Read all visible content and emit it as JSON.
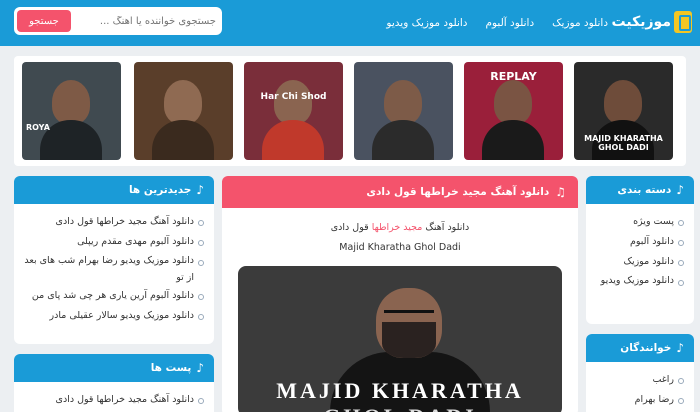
{
  "header": {
    "logo_text": "موزیکیت",
    "nav": [
      "دانلود موزیک",
      "دانلود آلبوم",
      "دانلود موزیک ویدیو"
    ],
    "search_placeholder": "جستجوی خواننده یا آهنگ ...",
    "search_button": "جستجو"
  },
  "carousel": {
    "cards": [
      {
        "label": "MAJID KHARATHA GHOL DADI",
        "bg": "#2a2a2a"
      },
      {
        "label": "REPLAY",
        "bg": "#9a1f3a"
      },
      {
        "label": "",
        "bg": "#4a5260"
      },
      {
        "label": "Har Chi Shod",
        "bg": "#7a2e3a"
      },
      {
        "label": "",
        "bg": "#5a3e2a"
      },
      {
        "label": "ROYA",
        "bg": "#404a50"
      }
    ]
  },
  "sidebar_right": {
    "categories": {
      "title": "دسته بندی",
      "items": [
        "پست ویژه",
        "دانلود آلبوم",
        "دانلود موزیک",
        "دانلود موزیک ویدیو"
      ]
    },
    "singers": {
      "title": "خوانندگان",
      "items": [
        "راغب",
        "رضا بهرام"
      ]
    }
  },
  "sidebar_left": {
    "latest": {
      "title": "جدیدترین ها",
      "items": [
        "دانلود آهنگ مجید خراطها قول دادی",
        "دانلود آلبوم مهدی مقدم ریپلی",
        "دانلود موزیک ویدیو رضا بهرام شب های بعد از تو",
        "دانلود آلبوم آرین یاری هر چی شد پای من",
        "دانلود موزیک ویدیو سالار عقیلی مادر"
      ]
    },
    "featured": {
      "title": "پست ها",
      "items": [
        "دانلود آهنگ مجید خراطها قول دادی"
      ]
    }
  },
  "main": {
    "title": "دانلود آهنگ مجید خراطها قول دادی",
    "line1_prefix": "دانلود آهنگ",
    "line1_artist": "مجید خراطها",
    "line1_suffix": "قول دادی",
    "line2": "Majid Kharatha Ghol Dadi",
    "cover_name": "MAJID KHARATHA",
    "cover_title": "GHOL DADI"
  },
  "colors": {
    "primary": "#1a9bd7",
    "accent": "#f4536c",
    "background": "#eceff2"
  }
}
